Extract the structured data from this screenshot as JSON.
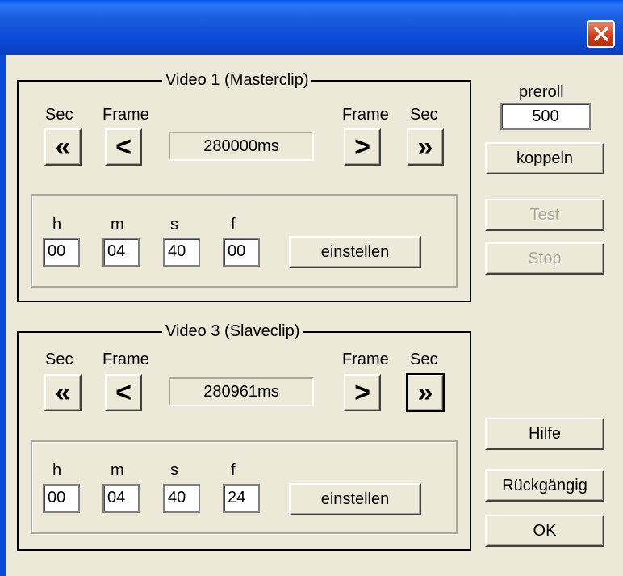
{
  "window": {
    "close_label": "×"
  },
  "video1": {
    "title": "Video 1 (Masterclip)",
    "sec_left": "Sec",
    "frame_left": "Frame",
    "frame_right": "Frame",
    "sec_right": "Sec",
    "btn_sec_back": "«",
    "btn_frame_back": "<",
    "btn_frame_fwd": ">",
    "btn_sec_fwd": "»",
    "position": "280000ms",
    "h_label": "h",
    "m_label": "m",
    "s_label": "s",
    "f_label": "f",
    "h": "00",
    "m": "04",
    "s": "40",
    "f": "00",
    "set_label": "einstellen"
  },
  "video3": {
    "title": "Video 3 (Slaveclip)",
    "sec_left": "Sec",
    "frame_left": "Frame",
    "frame_right": "Frame",
    "sec_right": "Sec",
    "btn_sec_back": "«",
    "btn_frame_back": "<",
    "btn_frame_fwd": ">",
    "btn_sec_fwd": "»",
    "position": "280961ms",
    "h_label": "h",
    "m_label": "m",
    "s_label": "s",
    "f_label": "f",
    "h": "00",
    "m": "04",
    "s": "40",
    "f": "24",
    "set_label": "einstellen"
  },
  "side": {
    "preroll_label": "preroll",
    "preroll_value": "500",
    "couple_label": "koppeln",
    "test_label": "Test",
    "stop_label": "Stop",
    "help_label": "Hilfe",
    "undo_label": "Rückgängig",
    "ok_label": "OK"
  }
}
